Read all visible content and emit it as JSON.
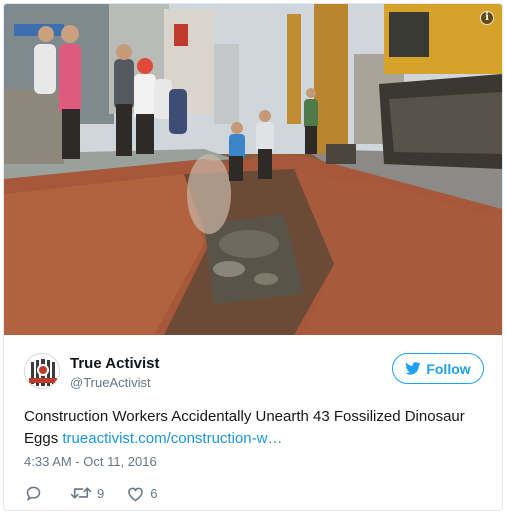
{
  "tweet": {
    "author": {
      "name": "True Activist",
      "handle": "@TrueActivist",
      "avatar_icon": "true-activist-logo"
    },
    "follow_label": "Follow",
    "text": "Construction Workers Accidentally Unearth 43 Fossilized Dinosaur Eggs",
    "link_text": "trueactivist.com/construction-w…",
    "timestamp": "4:33 AM - Oct 11, 2016",
    "actions": {
      "reply_icon": "reply-icon",
      "retweet_icon": "retweet-icon",
      "retweet_count": "9",
      "like_icon": "heart-icon",
      "like_count": "6"
    },
    "media": {
      "info_icon": "info-icon"
    }
  },
  "colors": {
    "accent": "#1da1f2",
    "link": "#1b95e0",
    "secondary_text": "#657786",
    "border": "#e1e8ed"
  }
}
